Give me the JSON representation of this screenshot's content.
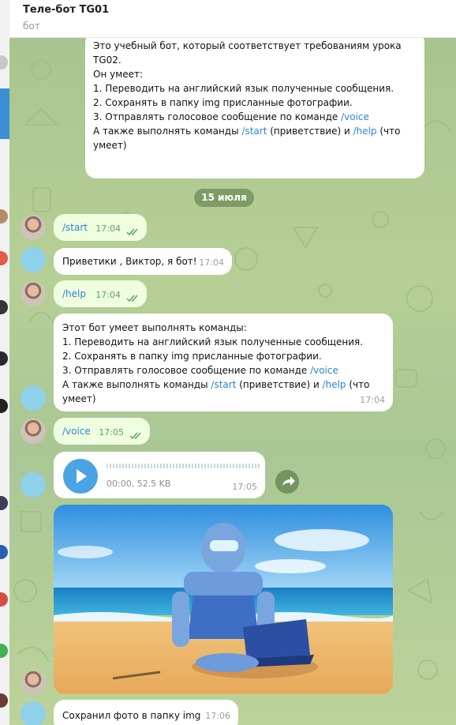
{
  "header": {
    "title": "Теле-бот TG01",
    "subtitle": "бот"
  },
  "chat": {
    "intro_message": {
      "lines": [
        "Это учебный бот, который соответствует требованиям урока",
        "TG02.",
        "Он умеет:",
        "1. Переводить на английский язык полученные сообщения.",
        "2. Сохранять в папку  img присланные фотографии.",
        "3. Отправлять голосовое сообщение по команде "
      ],
      "cmd_voice": "/voice",
      "also_prefix": "А также выполнять команды ",
      "cmd_start": "/start",
      "also_middle": " (приветствие) и  ",
      "cmd_help": "/help",
      "also_suffix": " (что",
      "last_line": "умеет)"
    },
    "date_divider": "15 июля",
    "messages": [
      {
        "id": "start",
        "text": "/start",
        "time": "17:04"
      },
      {
        "id": "greeting",
        "text": "Приветики , Виктор, я бот!",
        "time": "17:04"
      },
      {
        "id": "help",
        "text": "/help",
        "time": "17:04"
      },
      {
        "id": "help_reply",
        "lines": [
          "Этот бот умеет выполнять команды:",
          "1. Переводить на английский язык полученные сообщения.",
          "2. Сохранять в папку img присланные фотографии.",
          "3. Отправлять голосовое сообщение по команде "
        ],
        "cmd_voice": "/voice",
        "also_prefix": "А также выполнять команды ",
        "cmd_start": "/start",
        "also_middle": " (приветствие) и ",
        "cmd_help": "/help",
        "also_suffix": " (что",
        "last_line": "умеет)",
        "time": "17:04"
      },
      {
        "id": "voice",
        "text": "/voice",
        "time": "17:05"
      },
      {
        "id": "audio",
        "meta": "00:00, 52.5 KB",
        "time": "17:05"
      },
      {
        "id": "saved",
        "text": "Сохранил фото в папку img",
        "time": "17:06"
      }
    ]
  },
  "icons": {
    "play": "play-icon",
    "forward": "forward-icon",
    "read_ticks": "double-check-icon"
  },
  "colors": {
    "accent": "#3a8fd6",
    "command_link": "#2f84cf",
    "outgoing_bubble": "#eefedf",
    "incoming_bubble": "#ffffff",
    "chat_background": "#b2cc93"
  }
}
